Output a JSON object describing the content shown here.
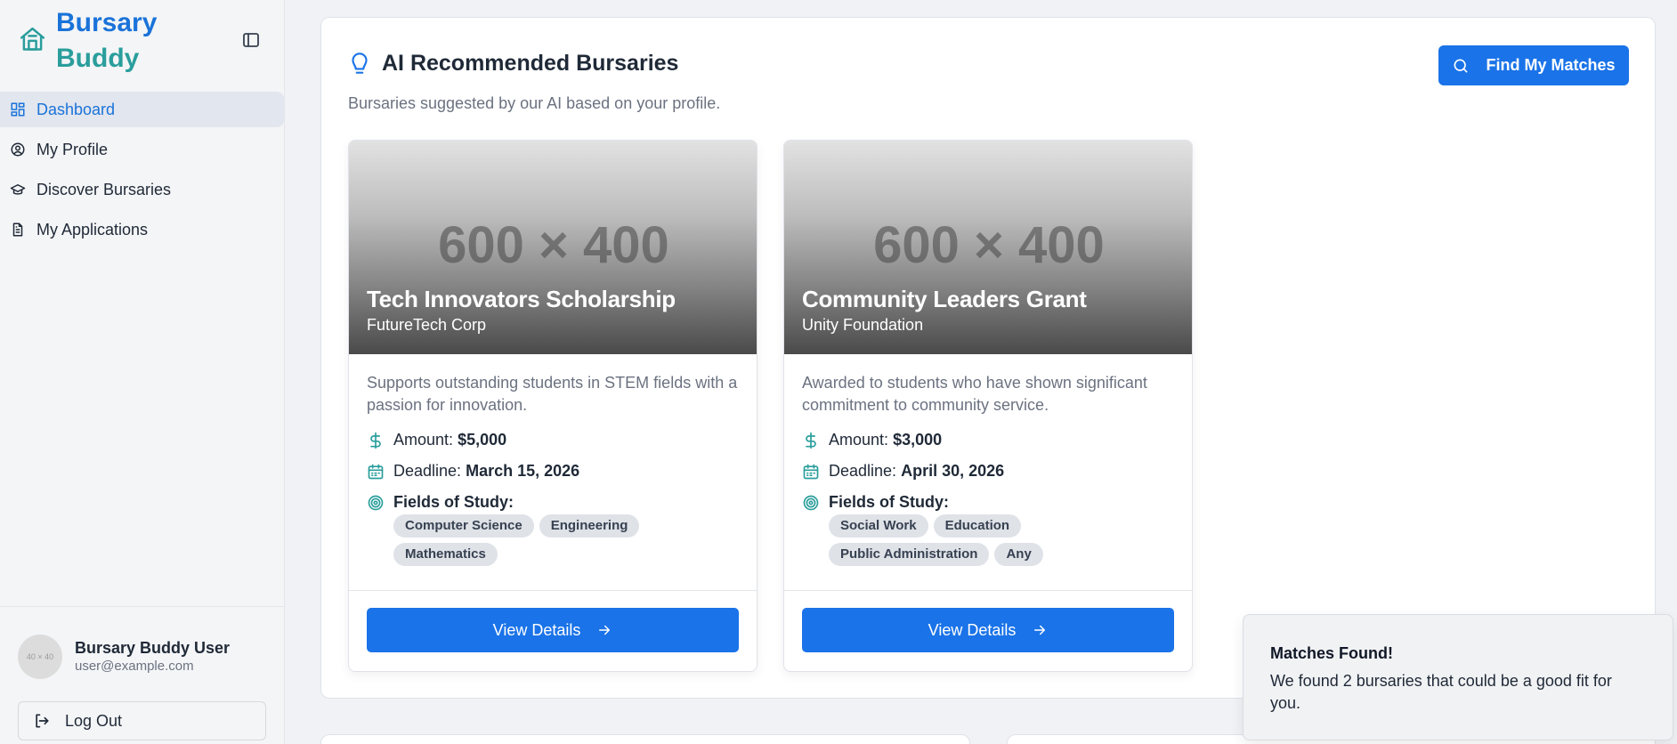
{
  "brand": {
    "line1": "Bursary",
    "line2": "Buddy"
  },
  "colors": {
    "primary": "#1a73e8",
    "teal": "#2a9e9c",
    "tag_bg": "#dfe2e7"
  },
  "sidebar": {
    "items": [
      {
        "label": "Dashboard",
        "icon": "dashboard-icon",
        "active": true
      },
      {
        "label": "My Profile",
        "icon": "user-circle-icon",
        "active": false
      },
      {
        "label": "Discover Bursaries",
        "icon": "graduation-cap-icon",
        "active": false
      },
      {
        "label": "My Applications",
        "icon": "document-icon",
        "active": false
      }
    ],
    "user": {
      "avatar_text": "40 × 40",
      "name": "Bursary Buddy User",
      "email": "user@example.com"
    },
    "logout_label": "Log Out"
  },
  "main": {
    "title": "AI Recommended Bursaries",
    "subtitle": "Bursaries suggested by our AI based on your profile.",
    "find_button": "Find My Matches",
    "cards": [
      {
        "image_placeholder": "600 × 400",
        "title": "Tech Innovators Scholarship",
        "org": "FutureTech Corp",
        "description": "Supports outstanding students in STEM fields with a passion for innovation.",
        "amount_label": "Amount:",
        "amount": "$5,000",
        "deadline_label": "Deadline:",
        "deadline": "March 15, 2026",
        "fields_label": "Fields of Study:",
        "fields": [
          "Computer Science",
          "Engineering",
          "Mathematics"
        ],
        "button": "View Details"
      },
      {
        "image_placeholder": "600 × 400",
        "title": "Community Leaders Grant",
        "org": "Unity Foundation",
        "description": "Awarded to students who have shown significant commitment to community service.",
        "amount_label": "Amount:",
        "amount": "$3,000",
        "deadline_label": "Deadline:",
        "deadline": "April 30, 2026",
        "fields_label": "Fields of Study:",
        "fields": [
          "Social Work",
          "Education",
          "Public Administration",
          "Any"
        ],
        "button": "View Details"
      }
    ]
  },
  "toast": {
    "title": "Matches Found!",
    "body": "We found 2 bursaries that could be a good fit for you."
  }
}
